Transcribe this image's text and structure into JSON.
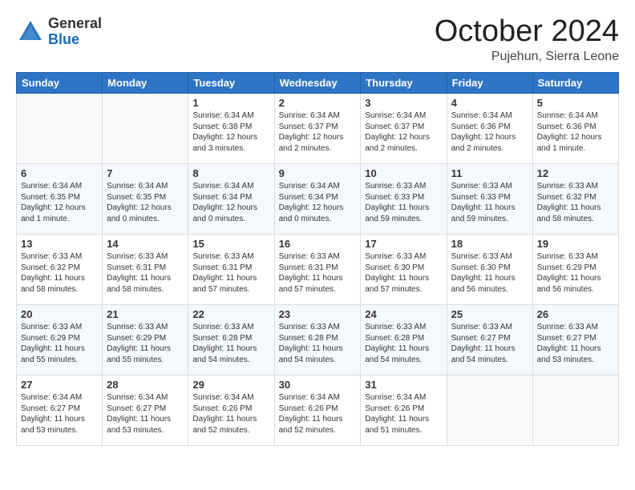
{
  "header": {
    "logo_general": "General",
    "logo_blue": "Blue",
    "month_title": "October 2024",
    "subtitle": "Pujehun, Sierra Leone"
  },
  "days_of_week": [
    "Sunday",
    "Monday",
    "Tuesday",
    "Wednesday",
    "Thursday",
    "Friday",
    "Saturday"
  ],
  "weeks": [
    [
      {
        "day": "",
        "info": ""
      },
      {
        "day": "",
        "info": ""
      },
      {
        "day": "1",
        "info": "Sunrise: 6:34 AM\nSunset: 6:38 PM\nDaylight: 12 hours\nand 3 minutes."
      },
      {
        "day": "2",
        "info": "Sunrise: 6:34 AM\nSunset: 6:37 PM\nDaylight: 12 hours\nand 2 minutes."
      },
      {
        "day": "3",
        "info": "Sunrise: 6:34 AM\nSunset: 6:37 PM\nDaylight: 12 hours\nand 2 minutes."
      },
      {
        "day": "4",
        "info": "Sunrise: 6:34 AM\nSunset: 6:36 PM\nDaylight: 12 hours\nand 2 minutes."
      },
      {
        "day": "5",
        "info": "Sunrise: 6:34 AM\nSunset: 6:36 PM\nDaylight: 12 hours\nand 1 minute."
      }
    ],
    [
      {
        "day": "6",
        "info": "Sunrise: 6:34 AM\nSunset: 6:35 PM\nDaylight: 12 hours\nand 1 minute."
      },
      {
        "day": "7",
        "info": "Sunrise: 6:34 AM\nSunset: 6:35 PM\nDaylight: 12 hours\nand 0 minutes."
      },
      {
        "day": "8",
        "info": "Sunrise: 6:34 AM\nSunset: 6:34 PM\nDaylight: 12 hours\nand 0 minutes."
      },
      {
        "day": "9",
        "info": "Sunrise: 6:34 AM\nSunset: 6:34 PM\nDaylight: 12 hours\nand 0 minutes."
      },
      {
        "day": "10",
        "info": "Sunrise: 6:33 AM\nSunset: 6:33 PM\nDaylight: 11 hours\nand 59 minutes."
      },
      {
        "day": "11",
        "info": "Sunrise: 6:33 AM\nSunset: 6:33 PM\nDaylight: 11 hours\nand 59 minutes."
      },
      {
        "day": "12",
        "info": "Sunrise: 6:33 AM\nSunset: 6:32 PM\nDaylight: 11 hours\nand 58 minutes."
      }
    ],
    [
      {
        "day": "13",
        "info": "Sunrise: 6:33 AM\nSunset: 6:32 PM\nDaylight: 11 hours\nand 58 minutes."
      },
      {
        "day": "14",
        "info": "Sunrise: 6:33 AM\nSunset: 6:31 PM\nDaylight: 11 hours\nand 58 minutes."
      },
      {
        "day": "15",
        "info": "Sunrise: 6:33 AM\nSunset: 6:31 PM\nDaylight: 11 hours\nand 57 minutes."
      },
      {
        "day": "16",
        "info": "Sunrise: 6:33 AM\nSunset: 6:31 PM\nDaylight: 11 hours\nand 57 minutes."
      },
      {
        "day": "17",
        "info": "Sunrise: 6:33 AM\nSunset: 6:30 PM\nDaylight: 11 hours\nand 57 minutes."
      },
      {
        "day": "18",
        "info": "Sunrise: 6:33 AM\nSunset: 6:30 PM\nDaylight: 11 hours\nand 56 minutes."
      },
      {
        "day": "19",
        "info": "Sunrise: 6:33 AM\nSunset: 6:29 PM\nDaylight: 11 hours\nand 56 minutes."
      }
    ],
    [
      {
        "day": "20",
        "info": "Sunrise: 6:33 AM\nSunset: 6:29 PM\nDaylight: 11 hours\nand 55 minutes."
      },
      {
        "day": "21",
        "info": "Sunrise: 6:33 AM\nSunset: 6:29 PM\nDaylight: 11 hours\nand 55 minutes."
      },
      {
        "day": "22",
        "info": "Sunrise: 6:33 AM\nSunset: 6:28 PM\nDaylight: 11 hours\nand 54 minutes."
      },
      {
        "day": "23",
        "info": "Sunrise: 6:33 AM\nSunset: 6:28 PM\nDaylight: 11 hours\nand 54 minutes."
      },
      {
        "day": "24",
        "info": "Sunrise: 6:33 AM\nSunset: 6:28 PM\nDaylight: 11 hours\nand 54 minutes."
      },
      {
        "day": "25",
        "info": "Sunrise: 6:33 AM\nSunset: 6:27 PM\nDaylight: 11 hours\nand 54 minutes."
      },
      {
        "day": "26",
        "info": "Sunrise: 6:33 AM\nSunset: 6:27 PM\nDaylight: 11 hours\nand 53 minutes."
      }
    ],
    [
      {
        "day": "27",
        "info": "Sunrise: 6:34 AM\nSunset: 6:27 PM\nDaylight: 11 hours\nand 53 minutes."
      },
      {
        "day": "28",
        "info": "Sunrise: 6:34 AM\nSunset: 6:27 PM\nDaylight: 11 hours\nand 53 minutes."
      },
      {
        "day": "29",
        "info": "Sunrise: 6:34 AM\nSunset: 6:26 PM\nDaylight: 11 hours\nand 52 minutes."
      },
      {
        "day": "30",
        "info": "Sunrise: 6:34 AM\nSunset: 6:26 PM\nDaylight: 11 hours\nand 52 minutes."
      },
      {
        "day": "31",
        "info": "Sunrise: 6:34 AM\nSunset: 6:26 PM\nDaylight: 11 hours\nand 51 minutes."
      },
      {
        "day": "",
        "info": ""
      },
      {
        "day": "",
        "info": ""
      }
    ]
  ]
}
